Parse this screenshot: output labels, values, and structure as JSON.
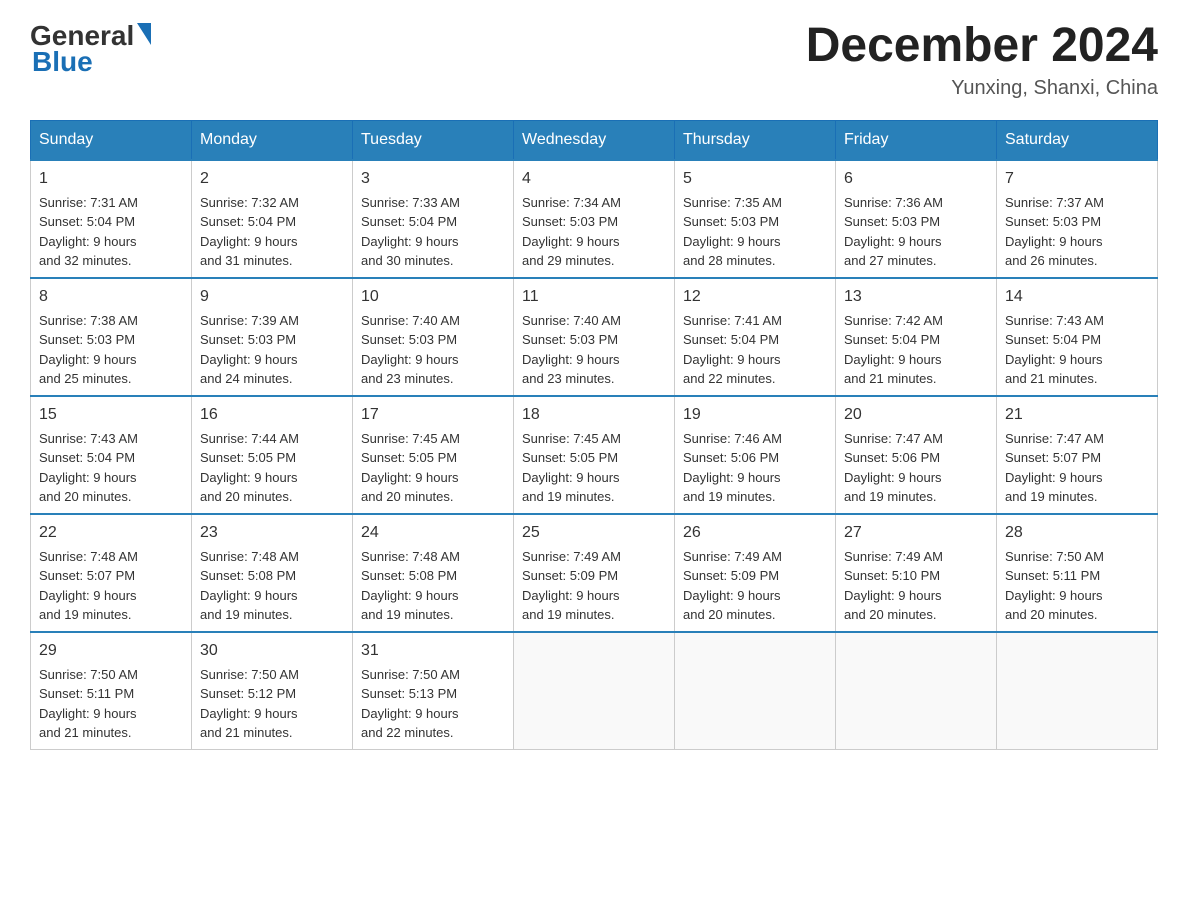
{
  "header": {
    "logo_general": "General",
    "logo_blue": "Blue",
    "month_title": "December 2024",
    "location": "Yunxing, Shanxi, China"
  },
  "calendar": {
    "days": [
      "Sunday",
      "Monday",
      "Tuesday",
      "Wednesday",
      "Thursday",
      "Friday",
      "Saturday"
    ],
    "weeks": [
      [
        {
          "day": "1",
          "info": "Sunrise: 7:31 AM\nSunset: 5:04 PM\nDaylight: 9 hours\nand 32 minutes."
        },
        {
          "day": "2",
          "info": "Sunrise: 7:32 AM\nSunset: 5:04 PM\nDaylight: 9 hours\nand 31 minutes."
        },
        {
          "day": "3",
          "info": "Sunrise: 7:33 AM\nSunset: 5:04 PM\nDaylight: 9 hours\nand 30 minutes."
        },
        {
          "day": "4",
          "info": "Sunrise: 7:34 AM\nSunset: 5:03 PM\nDaylight: 9 hours\nand 29 minutes."
        },
        {
          "day": "5",
          "info": "Sunrise: 7:35 AM\nSunset: 5:03 PM\nDaylight: 9 hours\nand 28 minutes."
        },
        {
          "day": "6",
          "info": "Sunrise: 7:36 AM\nSunset: 5:03 PM\nDaylight: 9 hours\nand 27 minutes."
        },
        {
          "day": "7",
          "info": "Sunrise: 7:37 AM\nSunset: 5:03 PM\nDaylight: 9 hours\nand 26 minutes."
        }
      ],
      [
        {
          "day": "8",
          "info": "Sunrise: 7:38 AM\nSunset: 5:03 PM\nDaylight: 9 hours\nand 25 minutes."
        },
        {
          "day": "9",
          "info": "Sunrise: 7:39 AM\nSunset: 5:03 PM\nDaylight: 9 hours\nand 24 minutes."
        },
        {
          "day": "10",
          "info": "Sunrise: 7:40 AM\nSunset: 5:03 PM\nDaylight: 9 hours\nand 23 minutes."
        },
        {
          "day": "11",
          "info": "Sunrise: 7:40 AM\nSunset: 5:03 PM\nDaylight: 9 hours\nand 23 minutes."
        },
        {
          "day": "12",
          "info": "Sunrise: 7:41 AM\nSunset: 5:04 PM\nDaylight: 9 hours\nand 22 minutes."
        },
        {
          "day": "13",
          "info": "Sunrise: 7:42 AM\nSunset: 5:04 PM\nDaylight: 9 hours\nand 21 minutes."
        },
        {
          "day": "14",
          "info": "Sunrise: 7:43 AM\nSunset: 5:04 PM\nDaylight: 9 hours\nand 21 minutes."
        }
      ],
      [
        {
          "day": "15",
          "info": "Sunrise: 7:43 AM\nSunset: 5:04 PM\nDaylight: 9 hours\nand 20 minutes."
        },
        {
          "day": "16",
          "info": "Sunrise: 7:44 AM\nSunset: 5:05 PM\nDaylight: 9 hours\nand 20 minutes."
        },
        {
          "day": "17",
          "info": "Sunrise: 7:45 AM\nSunset: 5:05 PM\nDaylight: 9 hours\nand 20 minutes."
        },
        {
          "day": "18",
          "info": "Sunrise: 7:45 AM\nSunset: 5:05 PM\nDaylight: 9 hours\nand 19 minutes."
        },
        {
          "day": "19",
          "info": "Sunrise: 7:46 AM\nSunset: 5:06 PM\nDaylight: 9 hours\nand 19 minutes."
        },
        {
          "day": "20",
          "info": "Sunrise: 7:47 AM\nSunset: 5:06 PM\nDaylight: 9 hours\nand 19 minutes."
        },
        {
          "day": "21",
          "info": "Sunrise: 7:47 AM\nSunset: 5:07 PM\nDaylight: 9 hours\nand 19 minutes."
        }
      ],
      [
        {
          "day": "22",
          "info": "Sunrise: 7:48 AM\nSunset: 5:07 PM\nDaylight: 9 hours\nand 19 minutes."
        },
        {
          "day": "23",
          "info": "Sunrise: 7:48 AM\nSunset: 5:08 PM\nDaylight: 9 hours\nand 19 minutes."
        },
        {
          "day": "24",
          "info": "Sunrise: 7:48 AM\nSunset: 5:08 PM\nDaylight: 9 hours\nand 19 minutes."
        },
        {
          "day": "25",
          "info": "Sunrise: 7:49 AM\nSunset: 5:09 PM\nDaylight: 9 hours\nand 19 minutes."
        },
        {
          "day": "26",
          "info": "Sunrise: 7:49 AM\nSunset: 5:09 PM\nDaylight: 9 hours\nand 20 minutes."
        },
        {
          "day": "27",
          "info": "Sunrise: 7:49 AM\nSunset: 5:10 PM\nDaylight: 9 hours\nand 20 minutes."
        },
        {
          "day": "28",
          "info": "Sunrise: 7:50 AM\nSunset: 5:11 PM\nDaylight: 9 hours\nand 20 minutes."
        }
      ],
      [
        {
          "day": "29",
          "info": "Sunrise: 7:50 AM\nSunset: 5:11 PM\nDaylight: 9 hours\nand 21 minutes."
        },
        {
          "day": "30",
          "info": "Sunrise: 7:50 AM\nSunset: 5:12 PM\nDaylight: 9 hours\nand 21 minutes."
        },
        {
          "day": "31",
          "info": "Sunrise: 7:50 AM\nSunset: 5:13 PM\nDaylight: 9 hours\nand 22 minutes."
        },
        {
          "day": "",
          "info": ""
        },
        {
          "day": "",
          "info": ""
        },
        {
          "day": "",
          "info": ""
        },
        {
          "day": "",
          "info": ""
        }
      ]
    ]
  }
}
